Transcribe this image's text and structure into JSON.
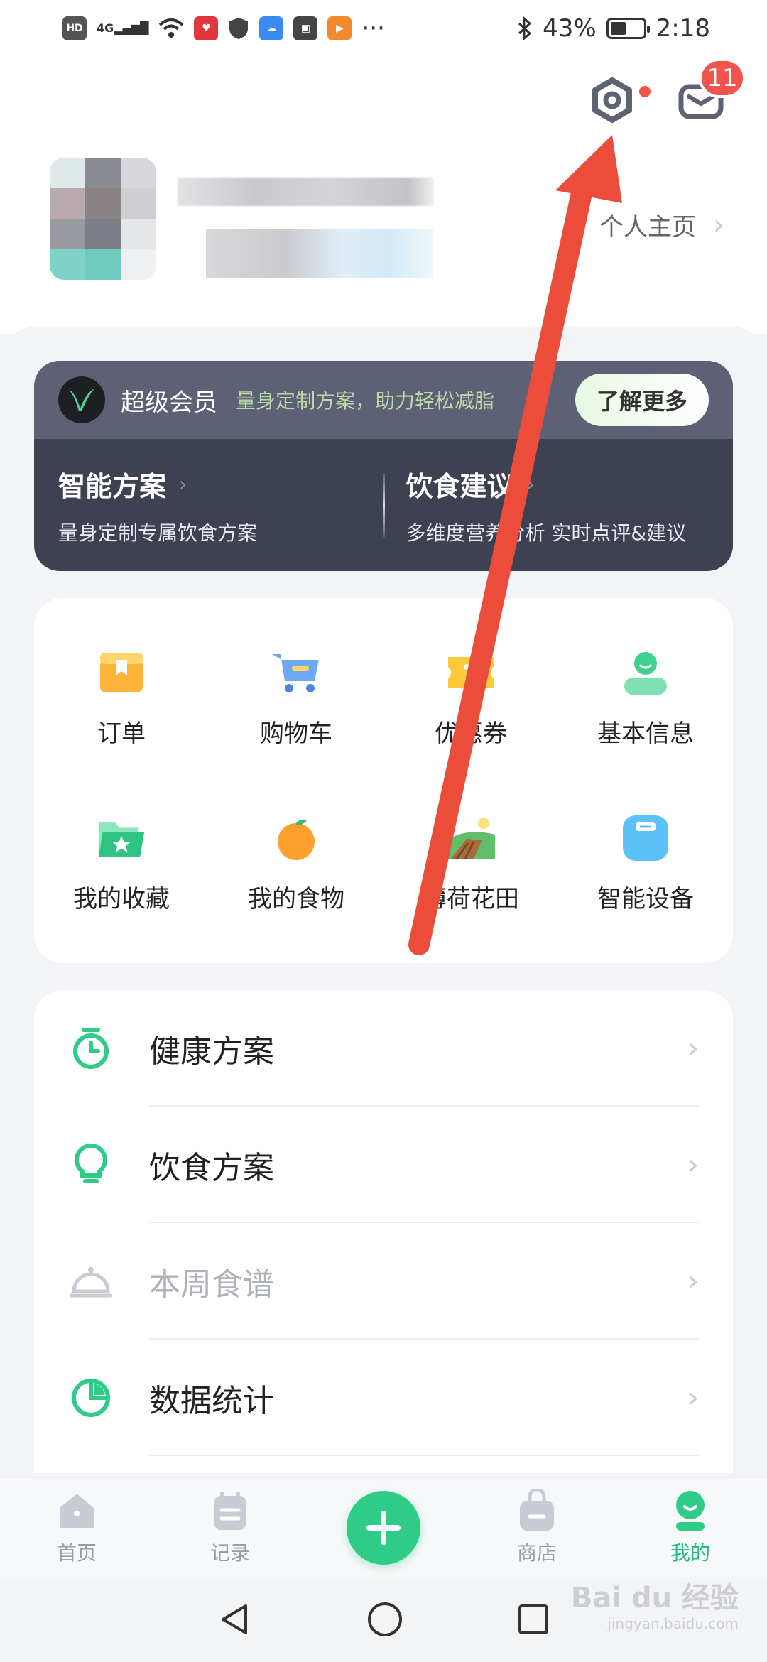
{
  "status": {
    "icons": [
      "hd-icon",
      "4g-signal-icon",
      "wifi-icon",
      "app-icon-red",
      "shield-icon",
      "cloud-icon",
      "huawei-icon",
      "video-icon",
      "more-icon"
    ],
    "hd": "HD",
    "signal": "4G",
    "battery": "43%",
    "time": "2:18",
    "more": "···"
  },
  "header": {
    "mail_badge": "11",
    "homepage_label": "个人主页"
  },
  "vip": {
    "title": "超级会员",
    "subtitle": "量身定制方案，助力轻松减脂",
    "button": "了解更多",
    "features": [
      {
        "title": "智能方案",
        "desc": "量身定制专属饮食方案"
      },
      {
        "title": "饮食建议",
        "desc": "多维度营养分析 实时点评&建议"
      }
    ]
  },
  "grid": [
    {
      "label": "订单",
      "icon": "order-box-icon"
    },
    {
      "label": "购物车",
      "icon": "shopping-cart-icon"
    },
    {
      "label": "优惠券",
      "icon": "coupon-icon"
    },
    {
      "label": "基本信息",
      "icon": "user-icon"
    },
    {
      "label": "我的收藏",
      "icon": "favorites-folder-icon"
    },
    {
      "label": "我的食物",
      "icon": "orange-icon"
    },
    {
      "label": "薄荷花田",
      "icon": "farm-field-icon"
    },
    {
      "label": "智能设备",
      "icon": "smart-scale-icon"
    }
  ],
  "list": [
    {
      "label": "健康方案",
      "icon": "timer-icon"
    },
    {
      "label": "饮食方案",
      "icon": "lightbulb-icon"
    },
    {
      "label": "本周食谱",
      "icon": "cloche-icon"
    },
    {
      "label": "数据统计",
      "icon": "pie-chart-icon"
    }
  ],
  "chevron": "›",
  "tabs": [
    {
      "label": "首页",
      "icon": "home-icon"
    },
    {
      "label": "记录",
      "icon": "record-icon"
    },
    {
      "label": "",
      "icon": "plus-icon"
    },
    {
      "label": "商店",
      "icon": "shop-bag-icon"
    },
    {
      "label": "我的",
      "icon": "profile-icon"
    }
  ],
  "colors": {
    "accent": "#2fcc87",
    "badge": "#f0544a",
    "vip_bg": "#3e4152",
    "arrow": "#ec4d3a"
  },
  "watermark": {
    "main": "Bai du 经验",
    "sub": "jingyan.baidu.com"
  }
}
